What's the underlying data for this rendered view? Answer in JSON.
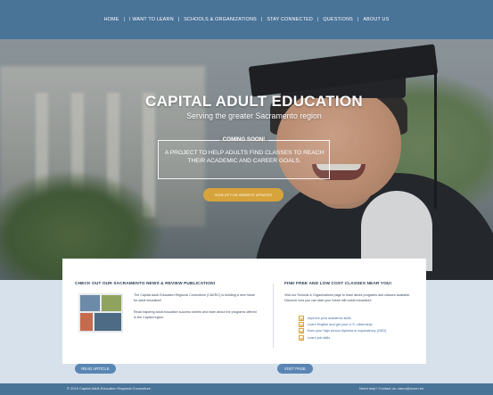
{
  "nav": {
    "items": [
      "HOME",
      "I WANT TO LEARN",
      "SCHOOLS & ORGANIZATIONS",
      "STAY CONNECTED",
      "QUESTIONS",
      "ABOUT US"
    ],
    "separator": "|"
  },
  "hero": {
    "title": "CAPITAL ADULT EDUCATION",
    "subtitle": "Serving the greater Sacramento region",
    "coming_soon": "COMING SOON!",
    "promo": "A PROJECT TO HELP ADULTS FIND CLASSES TO REACH THEIR ACADEMIC AND CAREER GOALS.",
    "signup_label": "SIGN UP FOR WEBSITE UPDATES"
  },
  "news": {
    "heading": "CHECK OUT OUR SACRAMENTO NEWS & REVIEW PUBLICATION!",
    "p1": "The Capital Adult Education Regional Consortium (CAERC) is building a new future for adult education!",
    "p2": "Read inspiring adult education success stories and learn about the programs offered in the Capital region.",
    "button": "READ ARTICLE"
  },
  "classes": {
    "heading": "FIND FREE AND LOW COST CLASSES NEAR YOU!",
    "p1": "Visit our Schools & Organizations page to learn about programs and classes available. Discover how you can start your future with adult education!",
    "items": [
      "Improve your academic skills",
      "Learn English and get your U.S. citizenship",
      "Earn your high school diploma or equivalency (GED)",
      "Learn job skills"
    ],
    "button": "VISIT PAGE"
  },
  "footer": {
    "copyright": "© 2016 Capital Adult Education Regional Consortium",
    "help": "Need help? Contact us: caerc@scoe.net"
  },
  "colors": {
    "nav_bg": "#4a7398",
    "accent": "#d7a43c",
    "button_blue": "#5a86b4",
    "page_bg": "#d6e1ec"
  }
}
